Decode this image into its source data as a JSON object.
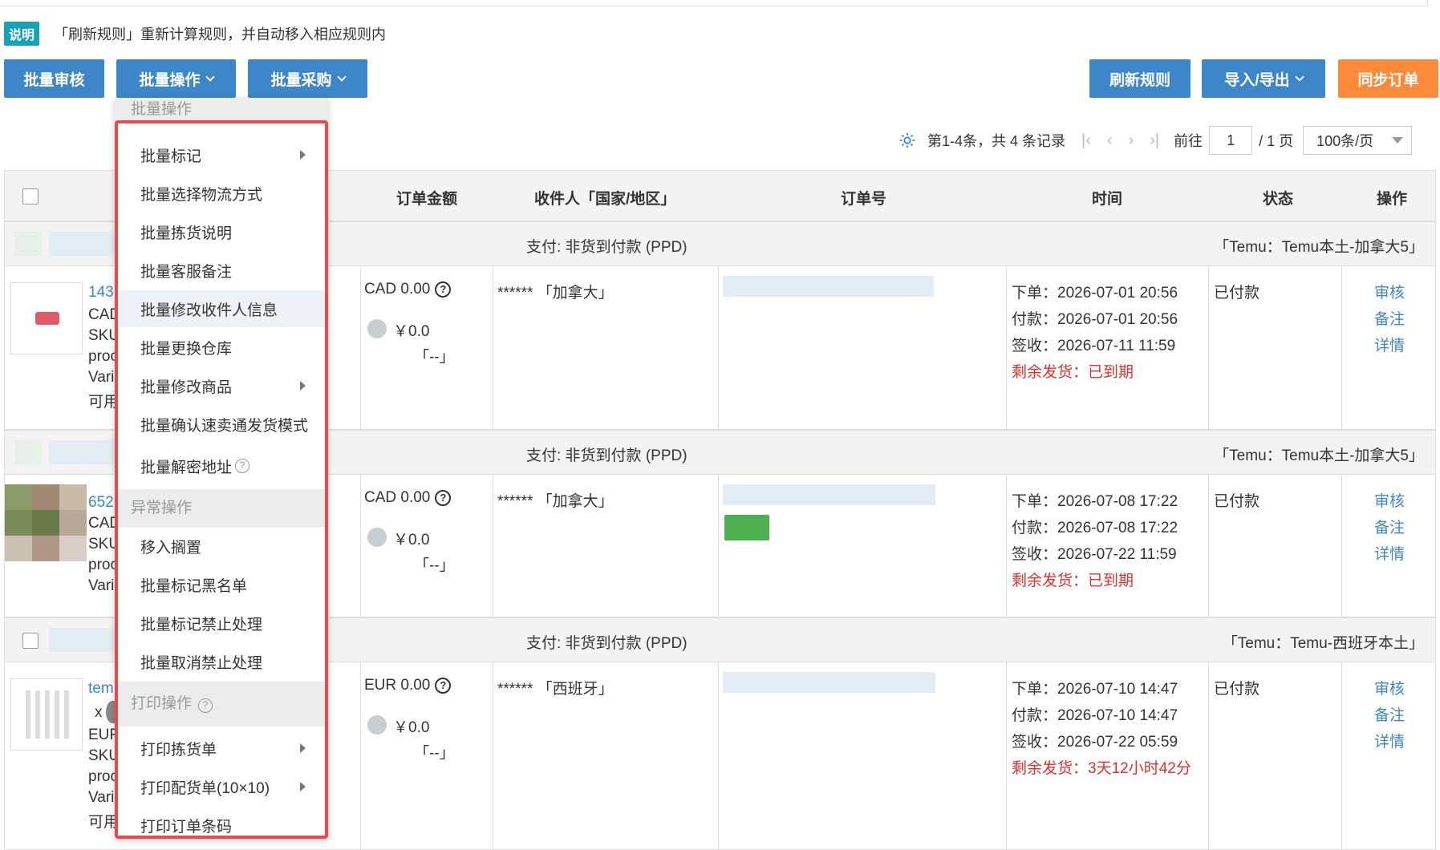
{
  "notice": {
    "badge": "说明",
    "text": "「刷新规则」重新计算规则，并自动移入相应规则内"
  },
  "toolbar": {
    "batch_review": "批量审核",
    "batch_ops": "批量操作",
    "batch_purchase": "批量采购",
    "refresh_rules": "刷新规则",
    "import_export": "导入/导出",
    "sync_orders": "同步订单"
  },
  "pager": {
    "summary": "第1-4条，共 4 条记录",
    "goto": "前往",
    "page": "1",
    "total": "/ 1 页",
    "size": "100条/页"
  },
  "table": {
    "headers": [
      "订单金额",
      "收件人「国家/地区」",
      "订单号",
      "时间",
      "状态",
      "操作"
    ]
  },
  "groups": [
    {
      "pay": "支付: 非货到付款 (PPD)",
      "shop": "「Temu：Temu本土-加拿大5」",
      "product_lines": [
        "143",
        "CAD",
        "SKU",
        "proc",
        "Vari",
        "可用"
      ],
      "amount": "CAD 0.00",
      "coin_amount": "￥0.0",
      "coin_note": "「--」",
      "recipient": "****** 「加拿大」",
      "times": [
        "下单：2026-07-01 20:56",
        "付款：2026-07-01 20:56",
        "签收：2026-07-11 11:59"
      ],
      "remain": "剩余发货：已到期",
      "status": "已付款",
      "actions": [
        "审核",
        "备注",
        "详情"
      ]
    },
    {
      "pay": "支付: 非货到付款 (PPD)",
      "shop": "「Temu：Temu本土-加拿大5」",
      "product_lines": [
        "652",
        "CAD",
        "SKU",
        "proc",
        "Vari"
      ],
      "amount": "CAD 0.00",
      "coin_amount": "￥0.0",
      "coin_note": "「--」",
      "recipient": "****** 「加拿大」",
      "times": [
        "下单：2026-07-08 17:22",
        "付款：2026-07-08 17:22",
        "签收：2026-07-22 11:59"
      ],
      "remain": "剩余发货：已到期",
      "status": "已付款",
      "actions": [
        "审核",
        "备注",
        "详情"
      ]
    },
    {
      "pay": "支付: 非货到付款 (PPD)",
      "shop": "「Temu：Temu-西班牙本土」",
      "product_lines": [
        "tem",
        "x",
        "EUF",
        "SKU",
        "proc",
        "Vari",
        "可用"
      ],
      "amount": "EUR 0.00",
      "coin_amount": "￥0.0",
      "coin_note": "「--」",
      "recipient": "****** 「西班牙」",
      "times": [
        "下单：2026-07-10 14:47",
        "付款：2026-07-10 14:47",
        "签收：2026-07-22 05:59"
      ],
      "remain": "剩余发货：3天12小时42分",
      "status": "已付款",
      "actions": [
        "审核",
        "备注",
        "详情"
      ]
    }
  ],
  "menu": {
    "header": "批量操作",
    "items1": [
      "批量标记",
      "批量选择物流方式",
      "批量拣货说明",
      "批量客服备注",
      "批量修改收件人信息",
      "批量更换仓库",
      "批量修改商品",
      "批量确认速卖通发货模式",
      "批量解密地址"
    ],
    "section2": "异常操作",
    "items2": [
      "移入搁置",
      "批量标记黑名单",
      "批量标记禁止处理",
      "批量取消禁止处理"
    ],
    "section3": "打印操作",
    "items3": [
      "打印拣货单",
      "打印配货单(10×10)",
      "打印订单条码"
    ]
  },
  "colors": {
    "primary": "#3d87c8",
    "orange": "#fb8b3a",
    "badge": "#17a2b8",
    "highlight": "#ea4a4a"
  }
}
